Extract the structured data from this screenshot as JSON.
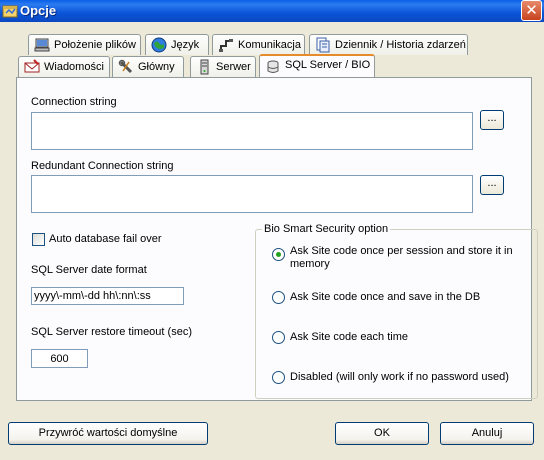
{
  "window": {
    "title": "Opcje"
  },
  "tabs_row1": [
    {
      "label": "Położenie plików",
      "icon": "computer-icon"
    },
    {
      "label": "Język",
      "icon": "globe-icon"
    },
    {
      "label": "Komunikacja",
      "icon": "network-icon"
    },
    {
      "label": "Dziennik / Historia zdarzeń",
      "icon": "event-log-icon"
    }
  ],
  "tabs_row2": [
    {
      "label": "Wiadomości",
      "icon": "message-icon"
    },
    {
      "label": "Główny",
      "icon": "wrench-icon"
    },
    {
      "label": "Serwer",
      "icon": "server-icon"
    },
    {
      "label": "SQL Server / BIO",
      "icon": "database-icon",
      "active": true
    }
  ],
  "form": {
    "connection_label": "Connection string",
    "connection_value": "",
    "redundant_label": "Redundant Connection string",
    "redundant_value": "",
    "browse_label": "...",
    "failover_label": "Auto database fail over",
    "failover_checked": false,
    "date_format_label": "SQL Server date format",
    "date_format_value": "yyyy\\-mm\\-dd hh\\:nn\\:ss",
    "timeout_label": "SQL Server restore timeout (sec)",
    "timeout_value": "600"
  },
  "bio_group": {
    "title": "Bio Smart Security option",
    "options": [
      {
        "line1": "Ask Site code once per session and store it in",
        "line2": "memory",
        "checked": true
      },
      {
        "line1": "Ask Site code once and save in the DB",
        "checked": false
      },
      {
        "line1": "Ask Site code each time",
        "checked": false
      },
      {
        "line1": "Disabled (will only work if no password used)",
        "checked": false
      }
    ]
  },
  "buttons": {
    "restore_defaults": "Przywróć wartości domyślne",
    "ok": "OK",
    "cancel": "Anuluj"
  },
  "colors": {
    "titlebar": "#0a54d8",
    "dialog_bg": "#ece9d8",
    "active_tab_accent": "#e68b2c",
    "input_border": "#7f9db9",
    "radio_dot": "#21a121"
  }
}
